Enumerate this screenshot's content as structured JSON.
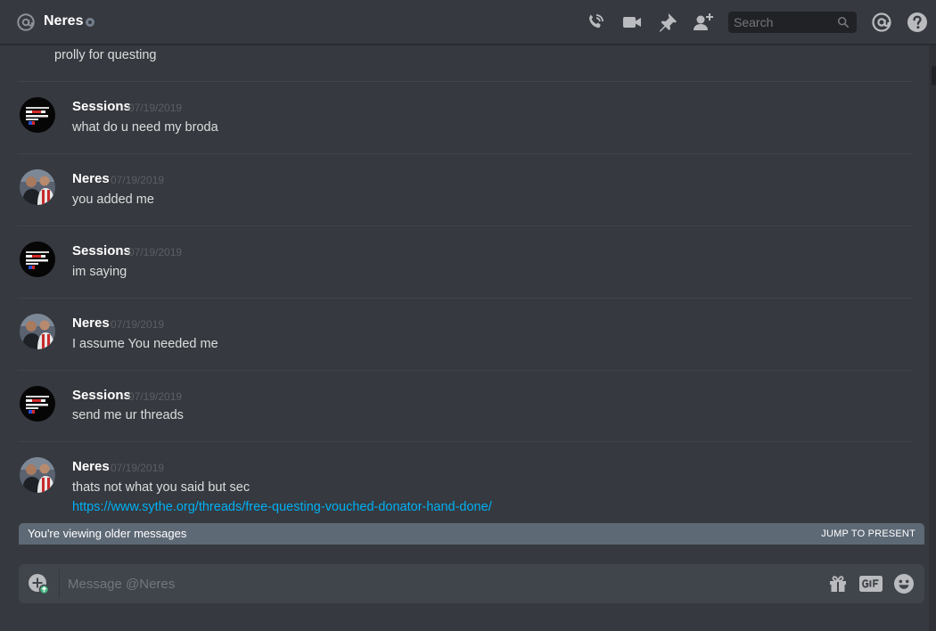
{
  "header": {
    "title": "Neres",
    "search_placeholder": "Search",
    "icons": [
      "at-icon",
      "status-dot",
      "call-icon",
      "video-icon",
      "pin-icon",
      "add-friend-icon",
      "search-icon",
      "mentions-icon",
      "help-icon"
    ]
  },
  "messages": [
    {
      "username": "",
      "timestamp": "",
      "lines": [
        "prolly for questing"
      ]
    },
    {
      "username": "Sessions",
      "timestamp": "07/19/2019",
      "lines": [
        "what do u need my broda"
      ]
    },
    {
      "username": "Neres",
      "timestamp": "07/19/2019",
      "lines": [
        "you added me"
      ]
    },
    {
      "username": "Sessions",
      "timestamp": "07/19/2019",
      "lines": [
        "im saying"
      ]
    },
    {
      "username": "Neres",
      "timestamp": "07/19/2019",
      "lines": [
        "I assume You needed me"
      ]
    },
    {
      "username": "Sessions",
      "timestamp": "07/19/2019",
      "lines": [
        "send me ur threads"
      ]
    },
    {
      "username": "Neres",
      "timestamp": "07/19/2019",
      "lines": [
        "thats not what you said but sec"
      ],
      "link": "https://www.sythe.org/threads/free-questing-vouched-donator-hand-done/"
    }
  ],
  "older_bar": {
    "text": "You're viewing older messages",
    "jump_label": "JUMP TO PRESENT"
  },
  "composer": {
    "placeholder": "Message @Neres",
    "icons": [
      "upload-icon",
      "gift-icon",
      "gif-icon",
      "emoji-icon"
    ]
  },
  "colors": {
    "background": "#36393f",
    "link": "#00b0f4",
    "older_bar": "#5e6976",
    "input": "#40444b"
  }
}
